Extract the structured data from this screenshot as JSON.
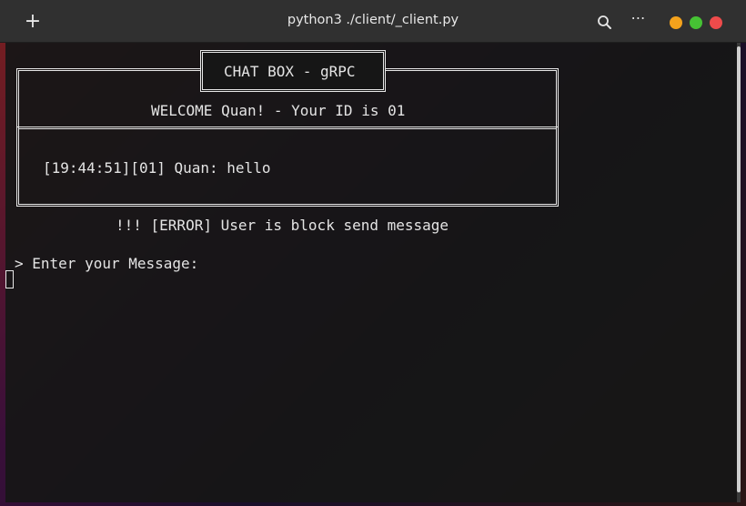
{
  "window": {
    "title": "python3 ./client/_client.py",
    "new_tab_icon": "plus-icon",
    "search_icon": "search-icon",
    "menu_icon": "ellipsis-icon",
    "menu_glyph": "⋯",
    "controls": {
      "minimize_color": "#f4a21c",
      "maximize_color": "#46c234",
      "close_color": "#ee4b4b"
    }
  },
  "terminal": {
    "box_title": "CHAT BOX - gRPC",
    "welcome": "WELCOME Quan! - Your ID is 01",
    "messages": [
      "[19:44:51][01] Quan: hello"
    ],
    "error": "!!! [ERROR] User is block send message",
    "prompt": "> Enter your Message:"
  }
}
